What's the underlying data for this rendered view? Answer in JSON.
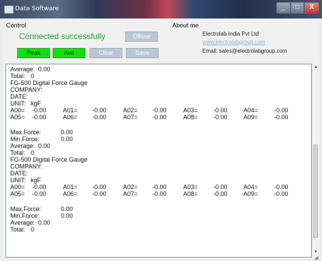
{
  "window": {
    "title": "Data Software",
    "minimize_glyph": "_",
    "maximize_glyph": "□",
    "close_glyph": "X"
  },
  "control": {
    "group_label": "Control",
    "status": "Connected successfully",
    "offline_label": "Offline",
    "peak_label": "Peak",
    "ave_label": "Ave",
    "clear_label": "Clear",
    "save_label": "Save"
  },
  "about": {
    "group_label": "About me",
    "company": "Electrolab India Pvt Ltd",
    "website": "www.electrolabgroup.com",
    "email": "Email: sales@electrolabgroup.com"
  },
  "colors": {
    "status_green": "#1f9f2c",
    "button_green": "#0ce10c",
    "button_disabled": "#b9c6d4",
    "link": "#8fb0d6"
  },
  "log": {
    "block0": {
      "average": "Average:  0.00",
      "total_label": "Total:",
      "total_value": "0"
    },
    "block1": {
      "device": "FG-500 Digital Force Gauge",
      "company": "COMPANY:",
      "date": "DATE:",
      "unit_label": "UNIT:",
      "unit_value": "kgF",
      "row1": [
        [
          "A00=",
          "-0.00"
        ],
        [
          "A01=",
          "-0.00"
        ],
        [
          "A02=",
          "-0.00"
        ],
        [
          "A03=",
          "-0.00"
        ],
        [
          "A04=",
          "-0.00"
        ]
      ],
      "row2": [
        [
          "A05=",
          "-0.00"
        ],
        [
          "A06=",
          "-0.00"
        ],
        [
          "A07=",
          "-0.00"
        ],
        [
          "A08=",
          "-0.00"
        ],
        [
          "A09=",
          "-0.00"
        ]
      ],
      "max_label": "Max.Force:",
      "max_value": "0.00",
      "min_label": "Min.Force:",
      "min_value": "0.00",
      "average": "Average:  0.00",
      "total_label": "Total:",
      "total_value": "0"
    },
    "block2": {
      "device": "FG-500 Digital Force Gauge",
      "company": "COMPANY:",
      "date": "DATE:",
      "unit_label": "UNIT:",
      "unit_value": "kgF",
      "row1": [
        [
          "A00=",
          "-0.00"
        ],
        [
          "A01=",
          "-0.00"
        ],
        [
          "A02=",
          "-0.00"
        ],
        [
          "A03=",
          "-0.00"
        ],
        [
          "A04=",
          "-0.00"
        ]
      ],
      "row2": [
        [
          "A05=",
          "-0.00"
        ],
        [
          "A06=",
          "-0.00"
        ],
        [
          "A07=",
          "-0.00"
        ],
        [
          "A08=",
          "-0.00"
        ],
        [
          "A09=",
          "-0.00"
        ]
      ],
      "max_label": "Max.Force:",
      "max_value": "0.00",
      "min_label": "Min.Force:",
      "min_value": "0.00",
      "average": "Average:  0.00",
      "total_label": "Total:",
      "total_value": "0"
    }
  }
}
